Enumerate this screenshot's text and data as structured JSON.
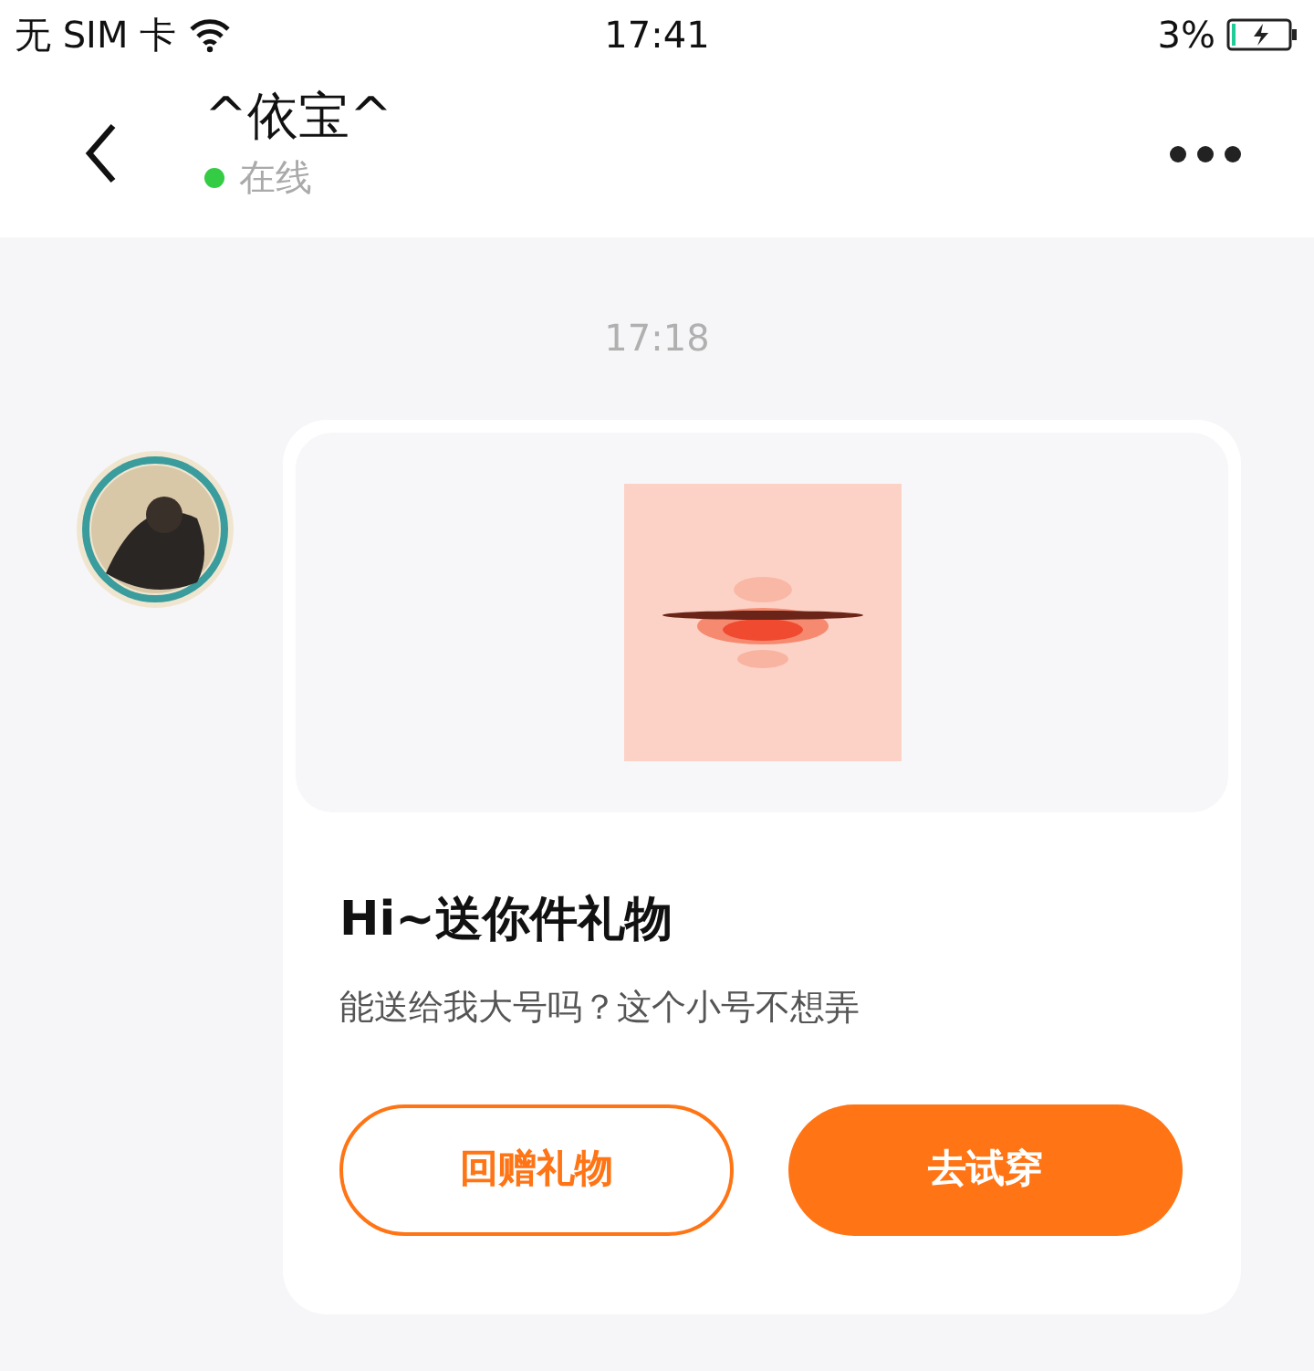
{
  "status_bar": {
    "carrier": "无 SIM 卡",
    "time": "17:41",
    "battery": "3%"
  },
  "header": {
    "title": "^依宝^",
    "status": "在线",
    "online": true
  },
  "chat": {
    "timestamp": "17:18",
    "gift_card": {
      "title": "Hi~送你件礼物",
      "message": "能送给我大号吗？这个小号不想弄",
      "buttons": [
        {
          "label": "回赠礼物",
          "kind": "outline"
        },
        {
          "label": "去试穿",
          "kind": "filled"
        }
      ]
    }
  }
}
